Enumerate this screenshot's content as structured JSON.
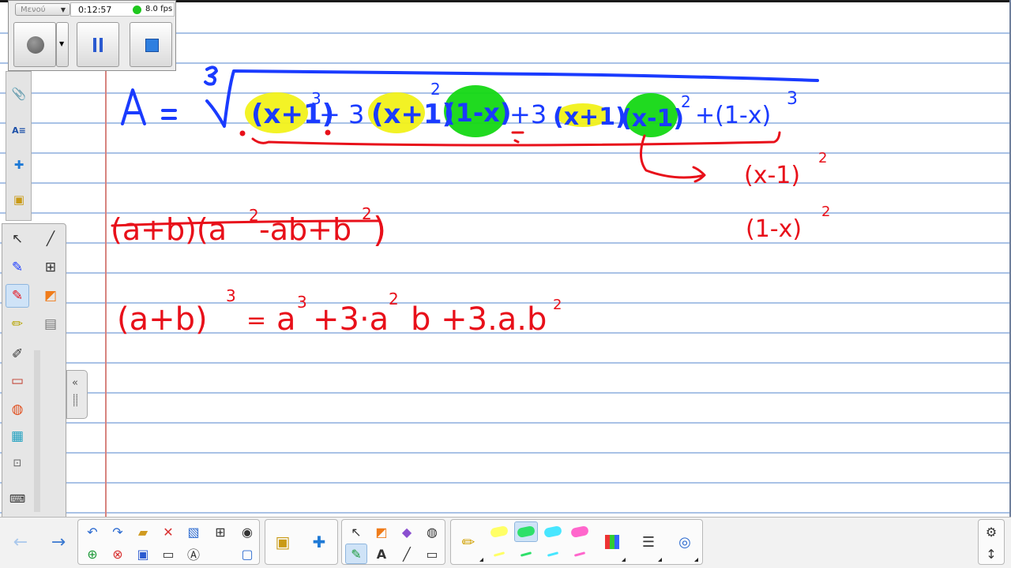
{
  "recorder": {
    "menu_label": "Μενού",
    "elapsed_time": "0:12:57",
    "fps": "8.0 fps",
    "status_color": "#1ec81e"
  },
  "whiteboard": {
    "ink_colors": {
      "blue": "#1a3bff",
      "red": "#e8101a",
      "yellow_highlight": "#f2f21a",
      "green_highlight": "#15d915"
    },
    "strokes": [
      {
        "id": "formula-A",
        "color": "blue",
        "text": "A = ∛((x+1)³ + 3(x+1)²(1−x) + 3(x+1)(x−1)² + (1−x)³)"
      },
      {
        "id": "note-x-minus-1",
        "color": "red",
        "text": "(x−1)²"
      },
      {
        "id": "note-1-minus-x",
        "color": "red",
        "text": "(1−x)²"
      },
      {
        "id": "crossed-out",
        "color": "red",
        "text": "(a+b)(a²−ab+b²)"
      },
      {
        "id": "identity",
        "color": "red",
        "text": "(a+b)³ = a³+3·a²b+3·a·b²"
      }
    ]
  },
  "left_tools": {
    "selected": "pen",
    "items": [
      "select",
      "line",
      "pen-blue",
      "ruler-tools",
      "pen",
      "shape",
      "highlighter",
      "print",
      "pencil",
      "eraser",
      "fill",
      "tablet",
      "screen",
      "keyboard",
      "calculator",
      "settings"
    ]
  },
  "bottom_toolbar": {
    "highlighter_colors": [
      "#ffff66",
      "#2ee06a",
      "#47e6ff",
      "#ff66cc"
    ],
    "selected_highlighter": "#2ee06a"
  }
}
